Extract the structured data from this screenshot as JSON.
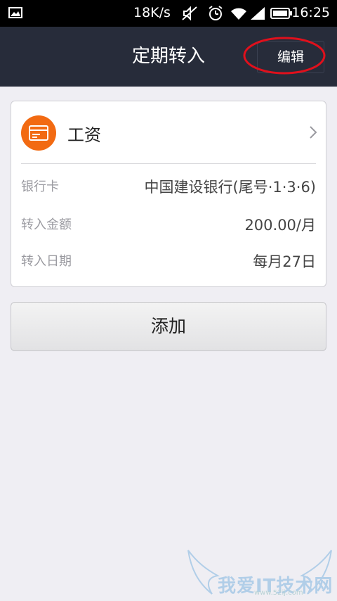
{
  "status_bar": {
    "speed": "18K/s",
    "time": "16:25",
    "icons": [
      "gallery-icon",
      "mute-icon",
      "alarm-icon",
      "wifi-icon",
      "signal-icon",
      "battery-icon"
    ]
  },
  "header": {
    "title": "定期转入",
    "edit_label": "编辑"
  },
  "card": {
    "title": "工资",
    "icon": "card-icon",
    "rows": [
      {
        "label": "银行卡",
        "value": "中国建设银行(尾号·1·3·6)"
      },
      {
        "label": "转入金额",
        "value": "200.00/月"
      },
      {
        "label": "转入日期",
        "value": "每月27日"
      }
    ]
  },
  "add_button": {
    "label": "添加"
  },
  "watermark": {
    "text": "我爱IT技术网",
    "sub": "www.52ij.com"
  },
  "colors": {
    "header_bg": "#272c3a",
    "accent_orange": "#f26a12",
    "page_bg": "#efeef3",
    "annotation_red": "#e0101c"
  }
}
